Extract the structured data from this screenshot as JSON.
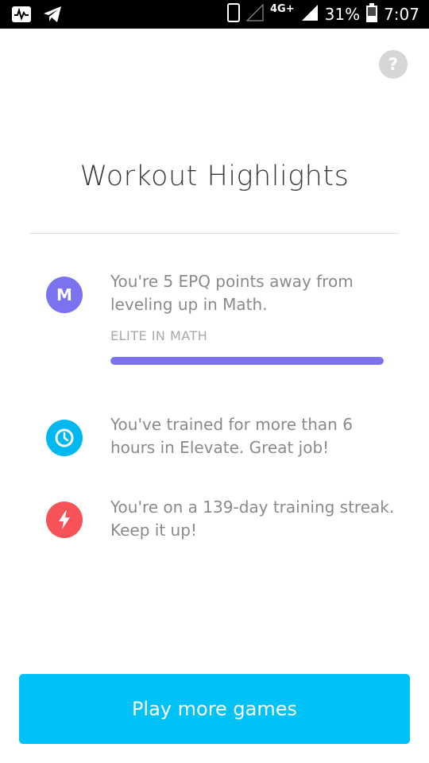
{
  "status_bar": {
    "network": "4G+",
    "battery": "31%",
    "time": "7:07",
    "icons": [
      "activity-icon",
      "telegram-icon",
      "phone-icon",
      "signal-icon",
      "battery-icon"
    ]
  },
  "help": {
    "label": "?"
  },
  "title": "Workout Highlights",
  "highlights": [
    {
      "icon_letter": "M",
      "icon": "math-icon",
      "color": "#7b72f0",
      "text": "You're 5 EPQ points away from leveling up in Math.",
      "progress_label": "ELITE IN MATH",
      "progress": 1.0
    },
    {
      "icon": "clock-icon",
      "color": "#00b8f0",
      "text": "You've trained for more than 6 hours in Elevate. Great job!"
    },
    {
      "icon": "lightning-icon",
      "color": "#f65257",
      "text": "You're on a 139-day training streak. Keep it up!"
    }
  ],
  "button": {
    "label": "Play more games",
    "color": "#00c2f6"
  },
  "colors": {
    "progress_fill": "#7b72f0"
  }
}
